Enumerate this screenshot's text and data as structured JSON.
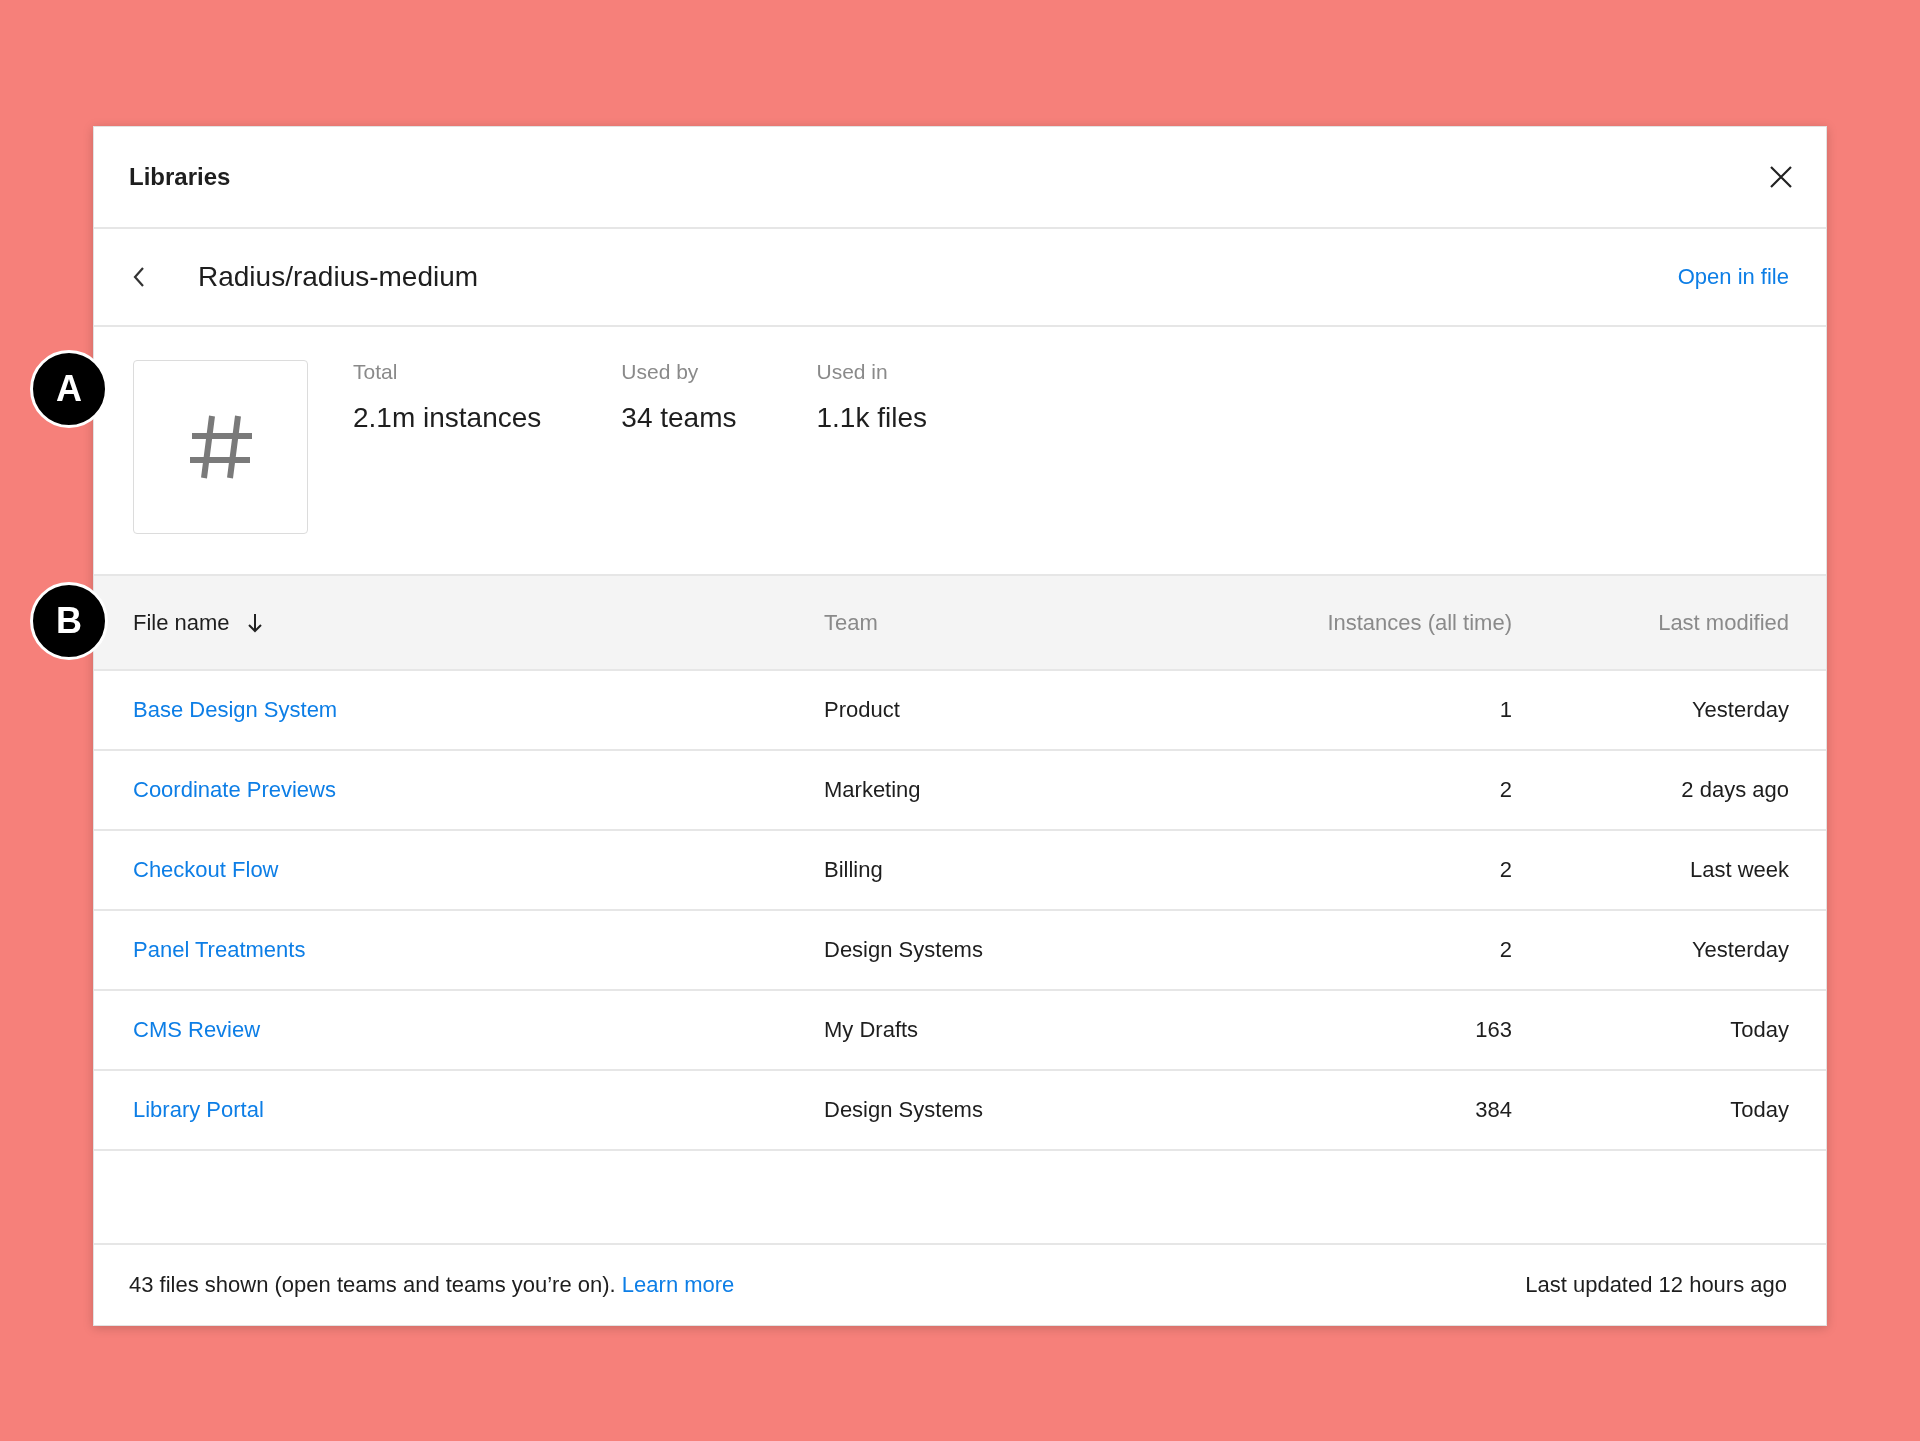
{
  "dialog": {
    "title": "Libraries"
  },
  "item": {
    "name": "Radius/radius-medium",
    "open_link": "Open in file"
  },
  "stats": {
    "annotation": "A",
    "items": [
      {
        "label": "Total",
        "value": "2.1m instances"
      },
      {
        "label": "Used by",
        "value": "34 teams"
      },
      {
        "label": "Used in",
        "value": "1.1k files"
      }
    ]
  },
  "table": {
    "annotation": "B",
    "columns": [
      {
        "label": "File name",
        "sorted": true
      },
      {
        "label": "Team",
        "sorted": false
      },
      {
        "label": "Instances (all time)",
        "sorted": false
      },
      {
        "label": "Last modified",
        "sorted": false
      }
    ],
    "rows": [
      {
        "file": "Base Design System",
        "team": "Product",
        "instances": "1",
        "modified": "Yesterday"
      },
      {
        "file": "Coordinate Previews",
        "team": "Marketing",
        "instances": "2",
        "modified": "2 days ago"
      },
      {
        "file": "Checkout Flow",
        "team": "Billing",
        "instances": "2",
        "modified": "Last week"
      },
      {
        "file": "Panel Treatments",
        "team": "Design Systems",
        "instances": "2",
        "modified": "Yesterday"
      },
      {
        "file": "CMS Review",
        "team": "My Drafts",
        "instances": "163",
        "modified": "Today"
      },
      {
        "file": "Library Portal",
        "team": "Design Systems",
        "instances": "384",
        "modified": "Today"
      }
    ]
  },
  "footer": {
    "text": "43 files shown (open teams and teams you’re on).",
    "link": "Learn more",
    "updated": "Last updated 12 hours ago"
  }
}
